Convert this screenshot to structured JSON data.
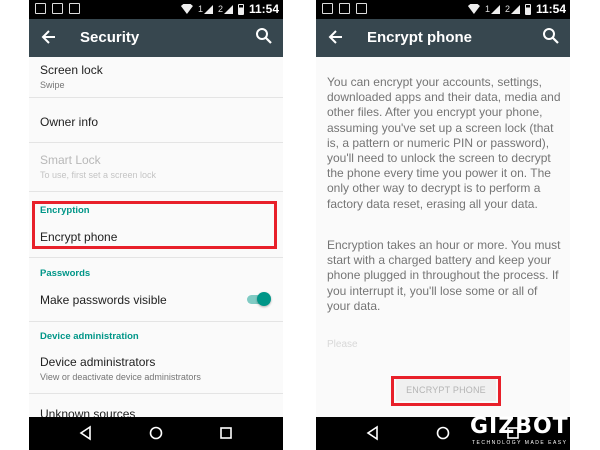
{
  "status_bar": {
    "time": "11:54",
    "sim1": "1",
    "sim2": "2"
  },
  "left_screen": {
    "title": "Security",
    "items": {
      "screen_lock": {
        "title": "Screen lock",
        "subtitle": "Swipe"
      },
      "owner_info": {
        "title": "Owner info"
      },
      "smart_lock": {
        "title": "Smart Lock",
        "subtitle": "To use, first set a screen lock"
      },
      "encryption_header": "Encryption",
      "encrypt_phone": {
        "title": "Encrypt phone"
      },
      "passwords_header": "Passwords",
      "make_passwords_visible": {
        "title": "Make passwords visible",
        "toggle_on": true
      },
      "device_admin_header": "Device administration",
      "device_administrators": {
        "title": "Device administrators",
        "subtitle": "View or deactivate device administrators"
      },
      "unknown_sources": {
        "title": "Unknown sources"
      }
    }
  },
  "right_screen": {
    "title": "Encrypt phone",
    "paragraph1": "You can encrypt your accounts, settings, downloaded apps and their data, media and other files. After you encrypt your phone, assuming you've set up a screen lock (that is, a pattern or numeric PIN or password), you'll need to unlock the screen to decrypt the phone every time you power it on. The only other way to decrypt is to perform a factory data reset, erasing all your data.",
    "paragraph2": "Encryption takes an hour or more. You must start with a charged battery and keep your phone plugged in throughout the process. If you interrupt it, you'll lose some or all of your data.",
    "faded_text": "Please",
    "button_label": "ENCRYPT PHONE"
  },
  "watermark": {
    "brand": "GIZBOT",
    "tagline": "TECHNOLOGY MADE EASY"
  },
  "colors": {
    "toolbar": "#37474f",
    "accent": "#009688",
    "highlight": "#e8202a"
  }
}
